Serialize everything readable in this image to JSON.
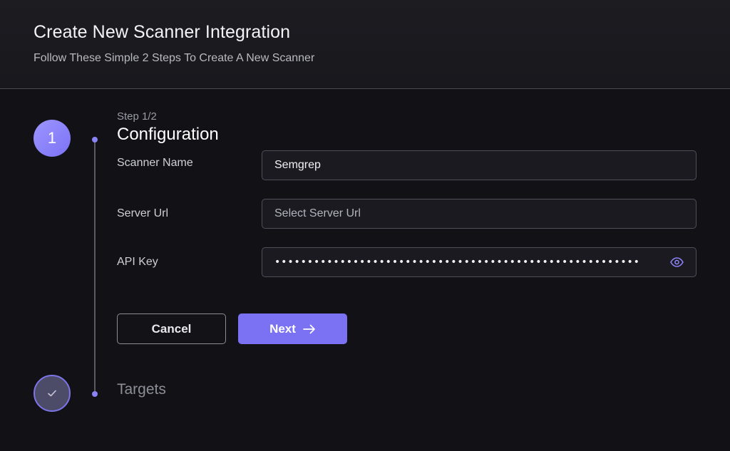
{
  "header": {
    "title": "Create New Scanner Integration",
    "subtitle": "Follow These Simple 2 Steps To Create A New Scanner"
  },
  "stepper": {
    "active_step_number": "1",
    "step_count": "Step 1/2",
    "active_step_title": "Configuration",
    "next_step_title": "Targets",
    "next_step_icon": "checkmark-icon",
    "accent_color": "#7b72f3"
  },
  "form": {
    "scanner_name": {
      "label": "Scanner Name",
      "value": "Semgrep"
    },
    "server_url": {
      "label": "Server Url",
      "placeholder": "Select Server Url"
    },
    "api_key": {
      "label": "API Key",
      "masked_value": "••••••••••••••••••••••••••••••••••••••••••••••••••••••••",
      "toggle_icon": "eye-icon"
    }
  },
  "actions": {
    "cancel_label": "Cancel",
    "next_label": "Next",
    "next_icon": "arrow-right-icon"
  }
}
